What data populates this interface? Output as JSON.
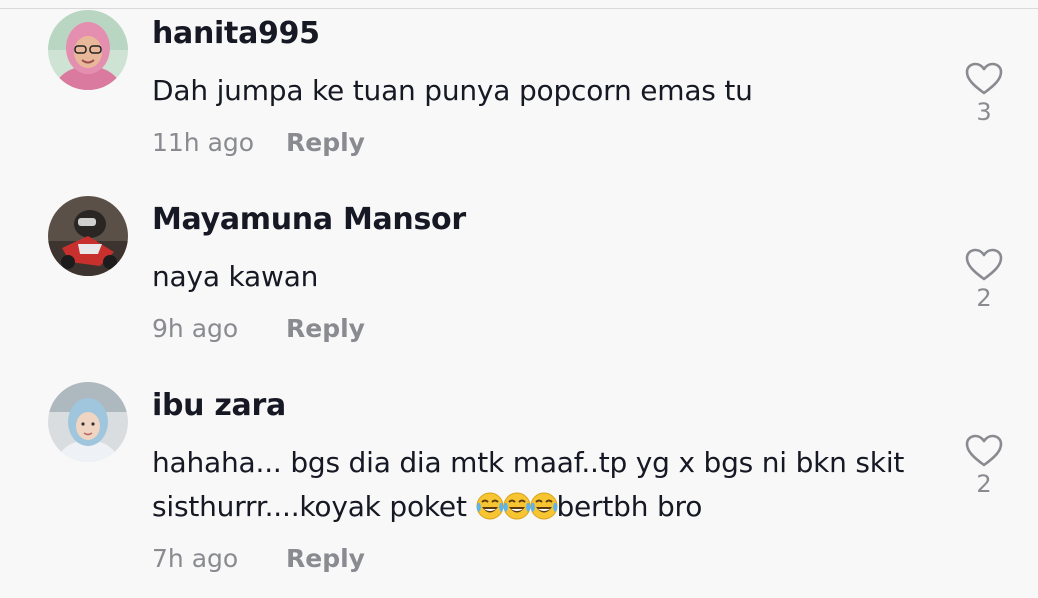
{
  "comments": [
    {
      "username": "hanita995",
      "text_parts": [
        "Dah jumpa ke tuan punya popcorn emas tu"
      ],
      "time": "11h ago",
      "reply_label": "Reply",
      "likes": "3"
    },
    {
      "username": "Mayamuna Mansor",
      "text_parts": [
        "naya kawan"
      ],
      "time": "9h ago",
      "reply_label": "Reply",
      "likes": "2"
    },
    {
      "username": "ibu zara",
      "text_parts": [
        "hahaha... bgs dia dia mtk maaf..tp yg x bgs ni bkn skit sisthurrr....koyak poket ",
        "bertbh bro"
      ],
      "emoji": "tears-of-joy x3",
      "time": "7h ago",
      "reply_label": "Reply",
      "likes": "2"
    }
  ],
  "colors": {
    "background": "#f8f8f8",
    "text": "#161823",
    "secondary": "#8a8b91"
  },
  "icons": {
    "like": "heart-outline-icon",
    "emoji": "face-with-tears-of-joy-icon"
  }
}
